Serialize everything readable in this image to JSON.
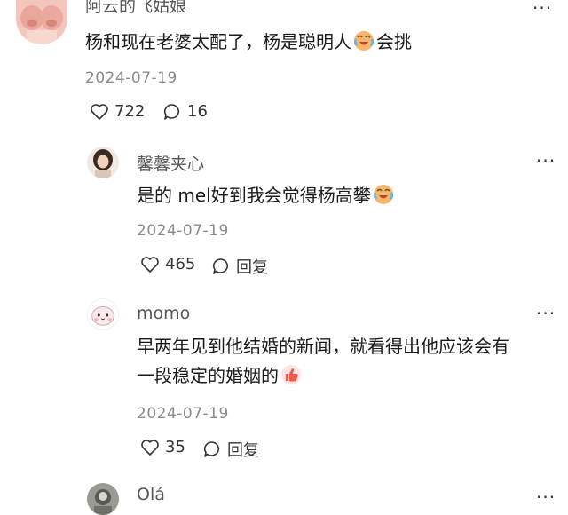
{
  "comments": [
    {
      "username": "阿云的飞姑娘",
      "text_before_emoji": "杨和现在老婆太配了，杨是聪明人",
      "text_after_emoji": "会挑",
      "emoji": "crying-laughing-emoji",
      "date": "2024-07-19",
      "likes": "722",
      "replies": "16"
    },
    {
      "username": "馨馨夹心",
      "text_before_emoji": "是的 mel好到我会觉得杨高攀",
      "emoji": "crying-laughing-emoji",
      "date": "2024-07-19",
      "likes": "465",
      "reply_label": "回复"
    },
    {
      "username": "momo",
      "text_line1": "早两年见到他结婚的新闻，就看得出他应该会有",
      "text_line2": "一段稳定的婚姻的",
      "emoji": "thumbs-up-emoji",
      "date": "2024-07-19",
      "likes": "35",
      "reply_label": "回复"
    },
    {
      "username": "Olá"
    }
  ],
  "more_menu_label": "···",
  "icons": {
    "like": "heart-outline-icon",
    "comment": "speech-bubble-icon",
    "more": "more-dots-icon"
  }
}
